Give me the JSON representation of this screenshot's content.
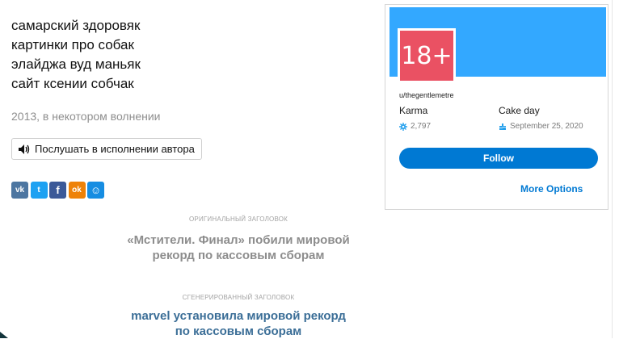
{
  "poem": {
    "lines": [
      "самарский здоровяк",
      "картинки про собак",
      "элайджа вуд маньяк",
      "сайт ксении собчак"
    ],
    "meta": "2013, в некотором волнении"
  },
  "listen": {
    "label": "Послушать в исполнении автора"
  },
  "social": [
    {
      "name": "vk",
      "glyph": "vk",
      "color": "#4d76a1"
    },
    {
      "name": "twitter",
      "glyph": "t",
      "color": "#1da1f2"
    },
    {
      "name": "facebook",
      "glyph": "f",
      "color": "#3b5998"
    },
    {
      "name": "odnoklassniki",
      "glyph": "ok",
      "color": "#ee8208"
    },
    {
      "name": "moimir",
      "glyph": "☺",
      "color": "#168de2"
    }
  ],
  "original_title": {
    "caption": "ОРИГИНАЛЬНЫЙ ЗАГОЛОВОК",
    "line1": "«Мстители. Финал» побили мировой",
    "line2": "рекорд по кассовым сборам"
  },
  "generated_title": {
    "caption": "СГЕНЕРИРОВАННЫЙ ЗАГОЛОВОК",
    "line1": "marvel установила мировой рекорд",
    "line2": "по кассовым сборам"
  },
  "reddit_card": {
    "avatar_text": "18+",
    "username": "u/thegentlemetre",
    "karma_label": "Karma",
    "karma_value": "2,797",
    "cakeday_label": "Cake day",
    "cakeday_value": "September 25, 2020",
    "follow_label": "Follow",
    "more_options_label": "More Options",
    "colors": {
      "banner": "#33a8ff",
      "avatar_bg": "#ea5163",
      "button": "#0079d3"
    }
  }
}
